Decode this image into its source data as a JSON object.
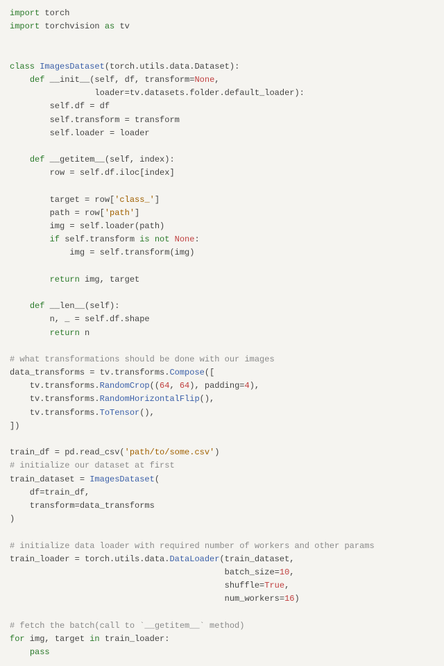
{
  "code": {
    "l01a": "import",
    "l01b": " torch",
    "l02a": "import",
    "l02b": " torchvision ",
    "l02c": "as",
    "l02d": " tv",
    "l03": "",
    "l04": "",
    "l05a": "class",
    "l05b": " ",
    "l05c": "ImagesDataset",
    "l05d": "(torch.utils.data.Dataset):",
    "l06a": "    ",
    "l06b": "def",
    "l06c": " __init__(self, df, transform=",
    "l06d": "None",
    "l06e": ",",
    "l07a": "                 loader=tv.datasets.folder.default_loader):",
    "l08a": "        self.df = df",
    "l09a": "        self.transform = transform",
    "l10a": "        self.loader = loader",
    "l11": "",
    "l12a": "    ",
    "l12b": "def",
    "l12c": " __getitem__(self, index):",
    "l13a": "        row = self.df.iloc[index]",
    "l14": "",
    "l15a": "        target = row[",
    "l15b": "'class_'",
    "l15c": "]",
    "l16a": "        path = row[",
    "l16b": "'path'",
    "l16c": "]",
    "l17a": "        img = self.loader(path)",
    "l18a": "        ",
    "l18b": "if",
    "l18c": " self.transform ",
    "l18d": "is",
    "l18e": " ",
    "l18f": "not",
    "l18g": " ",
    "l18h": "None",
    "l18i": ":",
    "l19a": "            img = self.transform(img)",
    "l20": "",
    "l21a": "        ",
    "l21b": "return",
    "l21c": " img, target",
    "l22": "",
    "l23a": "    ",
    "l23b": "def",
    "l23c": " __len__(self):",
    "l24a": "        n, _ = self.df.shape",
    "l25a": "        ",
    "l25b": "return",
    "l25c": " n",
    "l26": "",
    "l27a": "# what transformations should be done with our images",
    "l28a": "data_transforms = tv.transforms.",
    "l28b": "Compose",
    "l28c": "([",
    "l29a": "    tv.transforms.",
    "l29b": "RandomCrop",
    "l29c": "((",
    "l29d": "64",
    "l29e": ", ",
    "l29f": "64",
    "l29g": "), padding=",
    "l29h": "4",
    "l29i": "),",
    "l30a": "    tv.transforms.",
    "l30b": "RandomHorizontalFlip",
    "l30c": "(),",
    "l31a": "    tv.transforms.",
    "l31b": "ToTensor",
    "l31c": "(),",
    "l32a": "])",
    "l33": "",
    "l34a": "train_df = pd.read_csv(",
    "l34b": "'path/to/some.csv'",
    "l34c": ")",
    "l35a": "# initialize our dataset at first",
    "l36a": "train_dataset = ",
    "l36b": "ImagesDataset",
    "l36c": "(",
    "l37a": "    df=train_df,",
    "l38a": "    transform=data_transforms",
    "l39a": ")",
    "l40": "",
    "l41a": "# initialize data loader with required number of workers and other params",
    "l42a": "train_loader = torch.utils.data.",
    "l42b": "DataLoader",
    "l42c": "(train_dataset,",
    "l43a": "                                           batch_size=",
    "l43b": "10",
    "l43c": ",",
    "l44a": "                                           shuffle=",
    "l44b": "True",
    "l44c": ",",
    "l45a": "                                           num_workers=",
    "l45b": "16",
    "l45c": ")",
    "l46": "",
    "l47a": "# fetch the batch(call to `__getitem__` method)",
    "l48a": "for",
    "l48b": " img, target ",
    "l48c": "in",
    "l48d": " train_loader:",
    "l49a": "    ",
    "l49b": "pass"
  }
}
